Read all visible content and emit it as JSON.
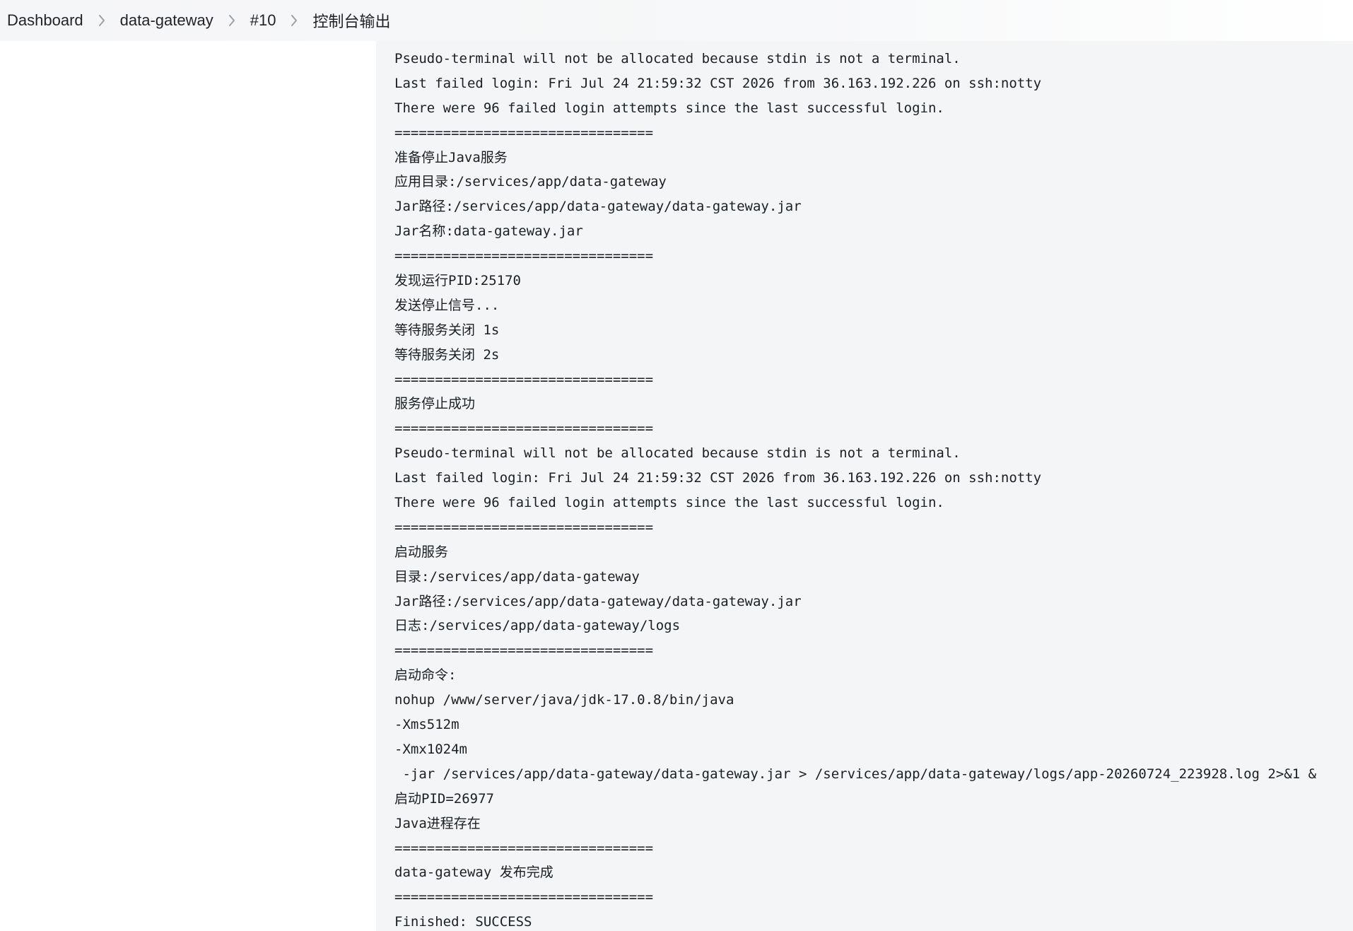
{
  "breadcrumb": {
    "items": [
      "Dashboard",
      "data-gateway",
      "#10",
      "控制台输出"
    ]
  },
  "console": {
    "lines": [
      "Pseudo-terminal will not be allocated because stdin is not a terminal.",
      "Last failed login: Fri Jul 24 21:59:32 CST 2026 from 36.163.192.226 on ssh:notty",
      "There were 96 failed login attempts since the last successful login.",
      "================================",
      "准备停止Java服务",
      "应用目录:/services/app/data-gateway",
      "Jar路径:/services/app/data-gateway/data-gateway.jar",
      "Jar名称:data-gateway.jar",
      "================================",
      "发现运行PID:25170",
      "发送停止信号...",
      "等待服务关闭 1s",
      "等待服务关闭 2s",
      "================================",
      "服务停止成功",
      "================================",
      "Pseudo-terminal will not be allocated because stdin is not a terminal.",
      "Last failed login: Fri Jul 24 21:59:32 CST 2026 from 36.163.192.226 on ssh:notty",
      "There were 96 failed login attempts since the last successful login.",
      "================================",
      "启动服务",
      "目录:/services/app/data-gateway",
      "Jar路径:/services/app/data-gateway/data-gateway.jar",
      "日志:/services/app/data-gateway/logs",
      "================================",
      "启动命令:",
      "nohup /www/server/java/jdk-17.0.8/bin/java",
      "-Xms512m",
      "-Xmx1024m",
      " -jar /services/app/data-gateway/data-gateway.jar > /services/app/data-gateway/logs/app-20260724_223928.log 2>&1 &",
      "启动PID=26977",
      "Java进程存在",
      "================================",
      "data-gateway 发布完成",
      "================================",
      "Finished: SUCCESS"
    ]
  },
  "colors": {
    "console_bg": "#f3f5f7",
    "text": "#1b1f23",
    "separator_icon": "#9aa1a9"
  }
}
